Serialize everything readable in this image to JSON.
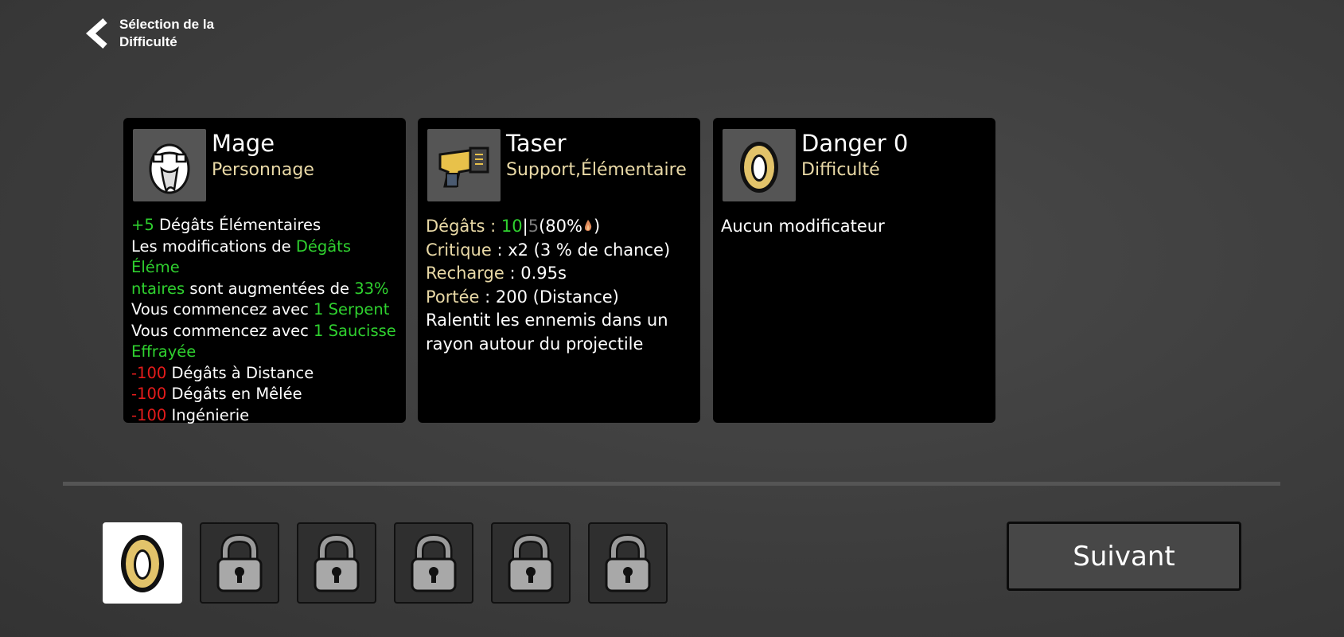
{
  "header": {
    "back_label": "Sélection de la Difficulté"
  },
  "cards": [
    {
      "title": "Mage",
      "subtitle": "Personnage",
      "icon": "mage-egg-icon",
      "lines": [
        {
          "a": "+5",
          "b": " Dégâts Élémentaires"
        },
        {
          "a": "Les modifications de ",
          "b": "Dégâts Éléme"
        },
        {
          "a": "ntaires",
          "b": " sont augmentées de ",
          "c": "33%"
        },
        {
          "a": "Vous commencez avec ",
          "b": "1 Serpent"
        },
        {
          "a": "Vous commencez avec ",
          "b": "1 Saucisse"
        },
        {
          "a": "Effrayée"
        },
        {
          "a": "-100",
          "b": " Dégâts à Distance"
        },
        {
          "a": "-100",
          "b": " Dégâts en Mêlée"
        },
        {
          "a": "-100",
          "b": " Ingénierie"
        }
      ]
    },
    {
      "title": "Taser",
      "subtitle": "Support,Élémentaire",
      "icon": "taser-icon",
      "stats": {
        "damage_label": "Dégâts",
        "damage_sep": " : ",
        "damage_value": "10",
        "damage_bar": "|",
        "damage_alt": "5",
        "damage_pct": "(80%",
        "damage_end": ")",
        "crit_label": "Critique",
        "crit_value": " : x2 (3 % de chance)",
        "reload_label": "Recharge",
        "reload_value": " : 0.95s",
        "range_label": "Portée",
        "range_value": " : 200 (Distance)",
        "desc1": "Ralentit les ennemis dans un",
        "desc2": "rayon autour du projectile"
      }
    },
    {
      "title": "Danger 0",
      "subtitle": "Difficulté",
      "icon": "danger-egg-icon",
      "text": "Aucun modificateur"
    }
  ],
  "difficulty_slots": [
    {
      "icon": "danger-egg-icon",
      "state": "selected"
    },
    {
      "icon": "lock-icon",
      "state": "locked"
    },
    {
      "icon": "lock-icon",
      "state": "locked"
    },
    {
      "icon": "lock-icon",
      "state": "locked"
    },
    {
      "icon": "lock-icon",
      "state": "locked"
    },
    {
      "icon": "lock-icon",
      "state": "locked"
    }
  ],
  "footer": {
    "next_label": "Suivant"
  },
  "colors": {
    "positive": "#2fd12f",
    "negative": "#e41b1b",
    "stat_label": "#e9d9a6",
    "card_bg": "#000000"
  }
}
